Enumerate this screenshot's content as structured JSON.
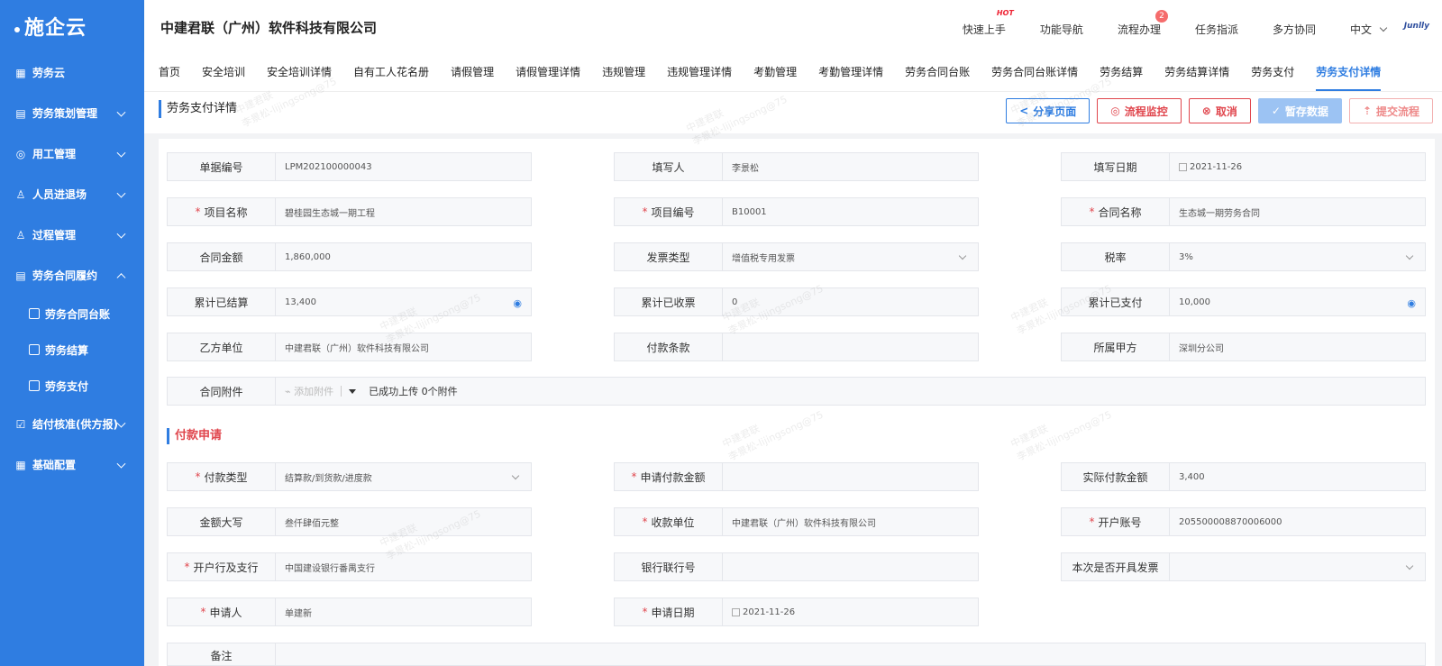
{
  "app": {
    "logo": "施企云",
    "company": "中建君联（广州）软件科技有限公司",
    "brand": "Junlly"
  },
  "sidebar": {
    "items": [
      {
        "label": "劳务云",
        "icon": "grid-icon"
      },
      {
        "label": "劳务策划管理",
        "icon": "plan-icon"
      },
      {
        "label": "用工管理",
        "icon": "worker-icon"
      },
      {
        "label": "人员进退场",
        "icon": "person-icon"
      },
      {
        "label": "过程管理",
        "icon": "process-icon"
      },
      {
        "label": "劳务合同履约",
        "icon": "contract-icon"
      },
      {
        "label": "劳务合同台账",
        "icon": "ledger-icon"
      },
      {
        "label": "劳务结算",
        "icon": "settle-icon"
      },
      {
        "label": "劳务支付",
        "icon": "pay-icon"
      },
      {
        "label": "结付核准(供方报)",
        "icon": "approve-icon"
      },
      {
        "label": "基础配置",
        "icon": "config-icon"
      }
    ]
  },
  "header": {
    "links": [
      "快速上手",
      "功能导航",
      "流程办理",
      "任务指派",
      "多方协同",
      "中文"
    ],
    "hot": "HOT",
    "badge": "2"
  },
  "tabs": [
    "首页",
    "安全培训",
    "安全培训详情",
    "自有工人花名册",
    "请假管理",
    "请假管理详情",
    "违规管理",
    "违规管理详情",
    "考勤管理",
    "考勤管理详情",
    "劳务合同台账",
    "劳务合同台账详情",
    "劳务结算",
    "劳务结算详情",
    "劳务支付",
    "劳务支付详情"
  ],
  "toolbar": {
    "title": "劳务支付详情",
    "share": "分享页面",
    "monitor": "流程监控",
    "cancel": "取消",
    "save": "暂存数据",
    "submit": "提交流程"
  },
  "form": {
    "doc_no": {
      "label": "单据编号",
      "value": "LPM202100000043"
    },
    "writer": {
      "label": "填写人",
      "value": "李景松"
    },
    "write_date": {
      "label": "填写日期",
      "value": "2021-11-26"
    },
    "project_name": {
      "label": "项目名称",
      "value": "碧桂园生态城一期工程"
    },
    "project_no": {
      "label": "项目编号",
      "value": "B10001"
    },
    "contract_name": {
      "label": "合同名称",
      "value": "生态城一期劳务合同"
    },
    "contract_amount": {
      "label": "合同金额",
      "value": "1,860,000"
    },
    "invoice_type": {
      "label": "发票类型",
      "value": "增值税专用发票"
    },
    "tax_rate": {
      "label": "税率",
      "value": "3%"
    },
    "settled": {
      "label": "累计已结算",
      "value": "13,400"
    },
    "received": {
      "label": "累计已收票",
      "value": "0"
    },
    "paid": {
      "label": "累计已支付",
      "value": "10,000"
    },
    "party_b": {
      "label": "乙方单位",
      "value": "中建君联（广州）软件科技有限公司"
    },
    "pay_terms": {
      "label": "付款条款",
      "value": ""
    },
    "party_a": {
      "label": "所属甲方",
      "value": "深圳分公司"
    },
    "attachment": {
      "label": "合同附件",
      "add": "添加附件",
      "note": "已成功上传 0个附件"
    }
  },
  "payment": {
    "section_title": "付款申请",
    "pay_type": {
      "label": "付款类型",
      "value": "结算款/到货款/进度款"
    },
    "apply_amount": {
      "label": "申请付款金额",
      "value": ""
    },
    "actual_amount": {
      "label": "实际付款金额",
      "value": "3,400"
    },
    "amount_upper": {
      "label": "金额大写",
      "value": "叁仟肆佰元整"
    },
    "payee": {
      "label": "收款单位",
      "value": "中建君联（广州）软件科技有限公司"
    },
    "account_no": {
      "label": "开户账号",
      "value": "205500008870006000"
    },
    "bank": {
      "label": "开户行及支行",
      "value": "中国建设银行番禺支行"
    },
    "bank_code": {
      "label": "银行联行号",
      "value": ""
    },
    "invoice_flag": {
      "label": "本次是否开具发票",
      "value": ""
    },
    "applicant": {
      "label": "申请人",
      "value": "单建新"
    },
    "apply_date": {
      "label": "申请日期",
      "value": "2021-11-26"
    },
    "remark": {
      "label": "备注",
      "value": ""
    }
  },
  "watermark": [
    "中建君联",
    "李景松-lijingsong@75"
  ]
}
